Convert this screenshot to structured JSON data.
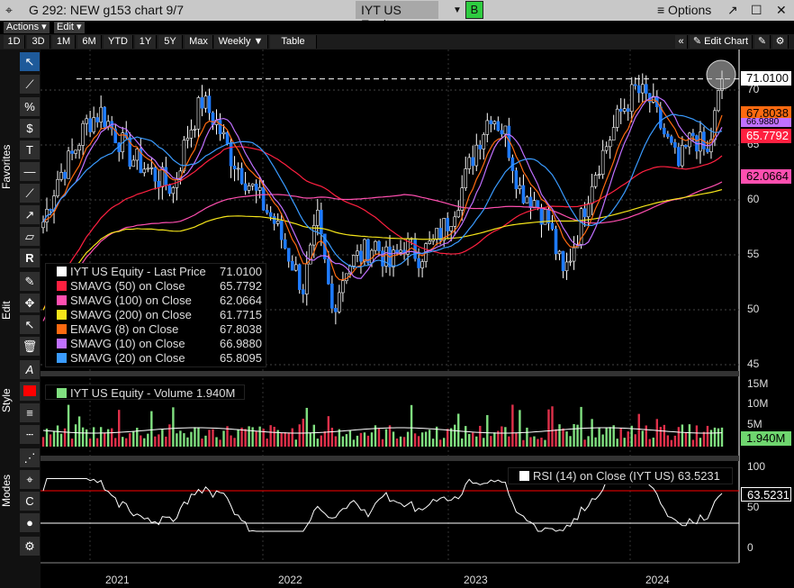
{
  "titlebar": {
    "title": "G 292: NEW g153 chart 9/7",
    "ticker": "IYT US Equity",
    "b": "B",
    "options": "≡ Options",
    "popout": "↗",
    "max": "☐",
    "close": "✕"
  },
  "menu": {
    "actions": "Actions ▾",
    "edit": "Edit ▾"
  },
  "toolbar": {
    "ranges": [
      "1D",
      "3D",
      "1M",
      "6M",
      "YTD",
      "1Y",
      "5Y",
      "Max"
    ],
    "period": "Weekly ▼",
    "table": "Table",
    "collapse": "«",
    "edit_chart": "✎ Edit Chart"
  },
  "side_tabs": {
    "favorites": "Favorites",
    "edit": "Edit",
    "style": "Style",
    "modes": "Modes"
  },
  "legend": [
    {
      "label": "IYT US Equity - Last Price",
      "value": "71.0100",
      "color": "#ffffff"
    },
    {
      "label": "SMAVG (50)  on Close",
      "value": "65.7792",
      "color": "#ff2040"
    },
    {
      "label": "SMAVG (100)  on Close",
      "value": "62.0664",
      "color": "#ff4fb0"
    },
    {
      "label": "SMAVG (200)  on Close",
      "value": "61.7715",
      "color": "#f5e51a"
    },
    {
      "label": "EMAVG (8)  on Close",
      "value": "67.8038",
      "color": "#ff6a10"
    },
    {
      "label": "SMAVG (10)  on Close",
      "value": "66.9880",
      "color": "#c070ff"
    },
    {
      "label": "SMAVG (20)  on Close",
      "value": "65.8095",
      "color": "#3a9bff"
    }
  ],
  "volume_legend": {
    "label": "IYT US Equity - Volume",
    "value": "1.940M",
    "color": "#80e080"
  },
  "rsi_legend": {
    "label": "RSI (14)  on Close (IYT US)",
    "value": "63.5231"
  },
  "price_axis": [
    "70",
    "65",
    "60",
    "55",
    "50",
    "45"
  ],
  "volume_axis": [
    "15M",
    "10M",
    "5M"
  ],
  "rsi_axis": [
    "100",
    "50",
    "0"
  ],
  "years": [
    "2021",
    "2022",
    "2023",
    "2024"
  ],
  "tags": {
    "last": "71.0100",
    "ema8": "67.8038",
    "sma10": "66.9880",
    "sma50": "65.7792",
    "sma100": "62.0664",
    "volume": "1.940M",
    "rsi": "63.5231"
  },
  "chart_data": {
    "type": "candlestick",
    "period": "weekly",
    "x_start": "2020-10",
    "x_end": "2024-09",
    "monthly_close": [
      58,
      62,
      64,
      67,
      68,
      66,
      64,
      63,
      62,
      61,
      66,
      69,
      67,
      64,
      62,
      60,
      58,
      55,
      52,
      58,
      50,
      54,
      55,
      56,
      54,
      56,
      55,
      56,
      58,
      61,
      65,
      68,
      66,
      61,
      60,
      58,
      53,
      57,
      62,
      65,
      68,
      70,
      69,
      66,
      63,
      66,
      64,
      71.01
    ],
    "ylim": [
      45,
      72
    ],
    "rsi_lines": [
      70,
      30
    ]
  }
}
